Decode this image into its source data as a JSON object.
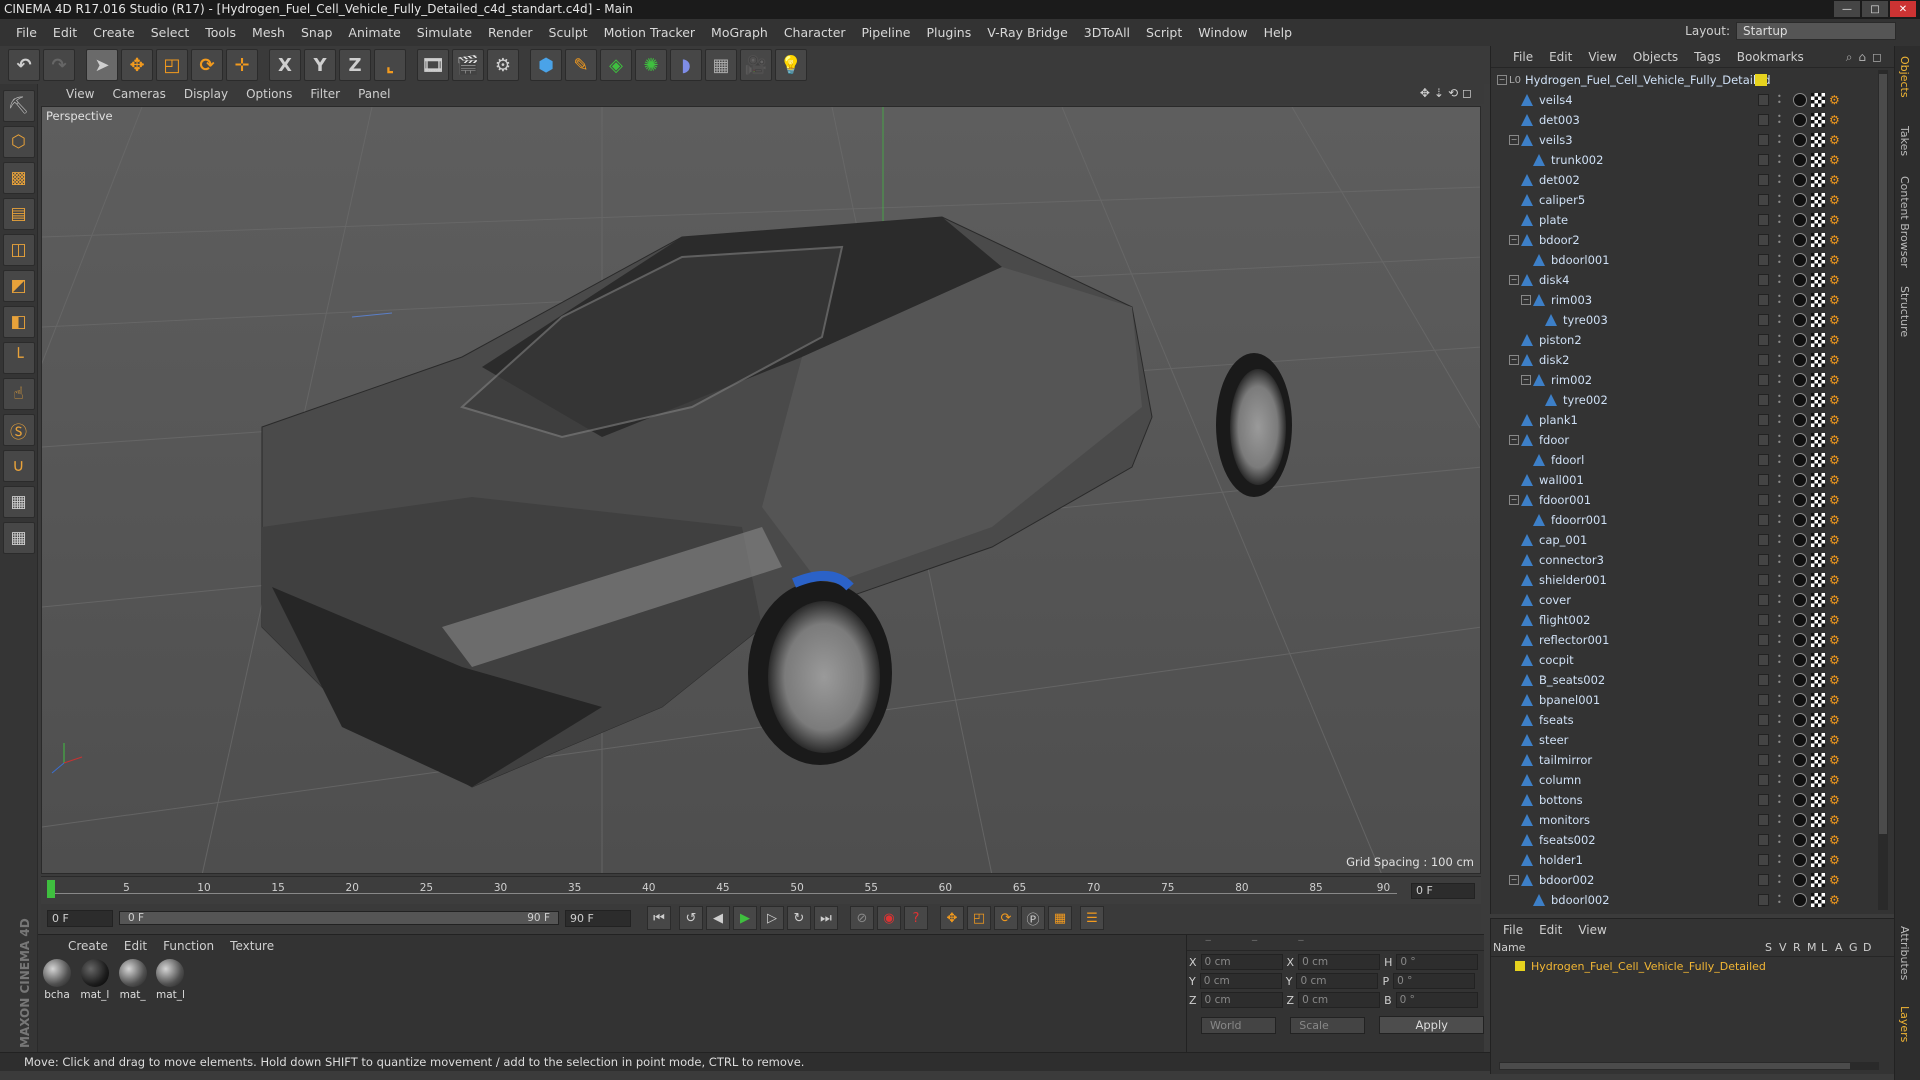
{
  "title": "CINEMA 4D R17.016 Studio (R17) - [Hydrogen_Fuel_Cell_Vehicle_Fully_Detailed_c4d_standart.c4d] - Main",
  "menu": [
    "File",
    "Edit",
    "Create",
    "Select",
    "Tools",
    "Mesh",
    "Snap",
    "Animate",
    "Simulate",
    "Render",
    "Sculpt",
    "Motion Tracker",
    "MoGraph",
    "Character",
    "Pipeline",
    "Plugins",
    "V-Ray Bridge",
    "3DToAll",
    "Script",
    "Window",
    "Help"
  ],
  "layout": {
    "label": "Layout:",
    "value": "Startup"
  },
  "toolbar_axes": [
    "X",
    "Y",
    "Z"
  ],
  "viewport": {
    "menu": [
      "View",
      "Cameras",
      "Display",
      "Options",
      "Filter",
      "Panel"
    ],
    "label": "Perspective",
    "grid_spacing": "Grid Spacing : 100 cm"
  },
  "timeline": {
    "ticks": [
      "0",
      "5",
      "10",
      "15",
      "20",
      "25",
      "30",
      "35",
      "40",
      "45",
      "50",
      "55",
      "60",
      "65",
      "70",
      "75",
      "80",
      "85",
      "90"
    ],
    "current": "0 F",
    "end_frame": "0 F",
    "range_start": "0 F",
    "range_start_inner": "0 F",
    "range_end_inner": "90 F",
    "range_end": "90 F"
  },
  "materials": {
    "menu": [
      "Create",
      "Edit",
      "Function",
      "Texture"
    ],
    "items": [
      "bcha",
      "mat_l",
      "mat_",
      "mat_l"
    ]
  },
  "coords": {
    "rows": [
      {
        "a": "X",
        "av": "0 cm",
        "b": "X",
        "bv": "0 cm",
        "c": "H",
        "cv": "0 °"
      },
      {
        "a": "Y",
        "av": "0 cm",
        "b": "Y",
        "bv": "0 cm",
        "c": "P",
        "cv": "0 °"
      },
      {
        "a": "Z",
        "av": "0 cm",
        "b": "Z",
        "bv": "0 cm",
        "c": "B",
        "cv": "0 °"
      }
    ],
    "mode": "World",
    "scale": "Scale",
    "apply": "Apply"
  },
  "objects": {
    "menu": [
      "File",
      "Edit",
      "View",
      "Objects",
      "Tags",
      "Bookmarks"
    ],
    "root": "Hydrogen_Fuel_Cell_Vehicle_Fully_Detailed",
    "items": [
      {
        "name": "veils4",
        "lvl": 1,
        "exp": false
      },
      {
        "name": "det003",
        "lvl": 1,
        "exp": false
      },
      {
        "name": "veils3",
        "lvl": 1,
        "exp": true
      },
      {
        "name": "trunk002",
        "lvl": 2,
        "exp": false
      },
      {
        "name": "det002",
        "lvl": 1,
        "exp": false
      },
      {
        "name": "caliper5",
        "lvl": 1,
        "exp": false
      },
      {
        "name": "plate",
        "lvl": 1,
        "exp": false
      },
      {
        "name": "bdoor2",
        "lvl": 1,
        "exp": true
      },
      {
        "name": "bdoorl001",
        "lvl": 2,
        "exp": false
      },
      {
        "name": "disk4",
        "lvl": 1,
        "exp": true
      },
      {
        "name": "rim003",
        "lvl": 2,
        "exp": true
      },
      {
        "name": "tyre003",
        "lvl": 3,
        "exp": false
      },
      {
        "name": "piston2",
        "lvl": 1,
        "exp": false
      },
      {
        "name": "disk2",
        "lvl": 1,
        "exp": true
      },
      {
        "name": "rim002",
        "lvl": 2,
        "exp": true
      },
      {
        "name": "tyre002",
        "lvl": 3,
        "exp": false
      },
      {
        "name": "plank1",
        "lvl": 1,
        "exp": false
      },
      {
        "name": "fdoor",
        "lvl": 1,
        "exp": true
      },
      {
        "name": "fdoorl",
        "lvl": 2,
        "exp": false
      },
      {
        "name": "wall001",
        "lvl": 1,
        "exp": false
      },
      {
        "name": "fdoor001",
        "lvl": 1,
        "exp": true
      },
      {
        "name": "fdoorr001",
        "lvl": 2,
        "exp": false
      },
      {
        "name": "cap_001",
        "lvl": 1,
        "exp": false
      },
      {
        "name": "connector3",
        "lvl": 1,
        "exp": false
      },
      {
        "name": "shielder001",
        "lvl": 1,
        "exp": false
      },
      {
        "name": "cover",
        "lvl": 1,
        "exp": false
      },
      {
        "name": "flight002",
        "lvl": 1,
        "exp": false
      },
      {
        "name": "reflector001",
        "lvl": 1,
        "exp": false
      },
      {
        "name": "cocpit",
        "lvl": 1,
        "exp": false
      },
      {
        "name": "B_seats002",
        "lvl": 1,
        "exp": false
      },
      {
        "name": "bpanel001",
        "lvl": 1,
        "exp": false
      },
      {
        "name": "fseats",
        "lvl": 1,
        "exp": false
      },
      {
        "name": "steer",
        "lvl": 1,
        "exp": false
      },
      {
        "name": "tailmirror",
        "lvl": 1,
        "exp": false
      },
      {
        "name": "column",
        "lvl": 1,
        "exp": false
      },
      {
        "name": "bottons",
        "lvl": 1,
        "exp": false
      },
      {
        "name": "monitors",
        "lvl": 1,
        "exp": false
      },
      {
        "name": "fseats002",
        "lvl": 1,
        "exp": false
      },
      {
        "name": "holder1",
        "lvl": 1,
        "exp": false
      },
      {
        "name": "bdoor002",
        "lvl": 1,
        "exp": true
      },
      {
        "name": "bdoorl002",
        "lvl": 2,
        "exp": false
      }
    ]
  },
  "attributes": {
    "menu": [
      "File",
      "Edit",
      "View"
    ],
    "columns": [
      "Name",
      "S",
      "V",
      "R",
      "M",
      "L",
      "A",
      "G",
      "D"
    ],
    "row": "Hydrogen_Fuel_Cell_Vehicle_Fully_Detailed"
  },
  "side_tabs": [
    "Objects",
    "Takes",
    "Content Browser",
    "Structure",
    "Attributes",
    "Layers"
  ],
  "status": "Move: Click and drag to move elements. Hold down SHIFT to quantize movement / add to the selection in point mode, CTRL to remove.",
  "brand": "MAXON CINEMA 4D",
  "colors": {
    "accent": "#f29a1e",
    "object_icon": "#3d7fc7",
    "root_tag": "#e6d21e",
    "timeline_cursor": "#3fbf3f"
  }
}
